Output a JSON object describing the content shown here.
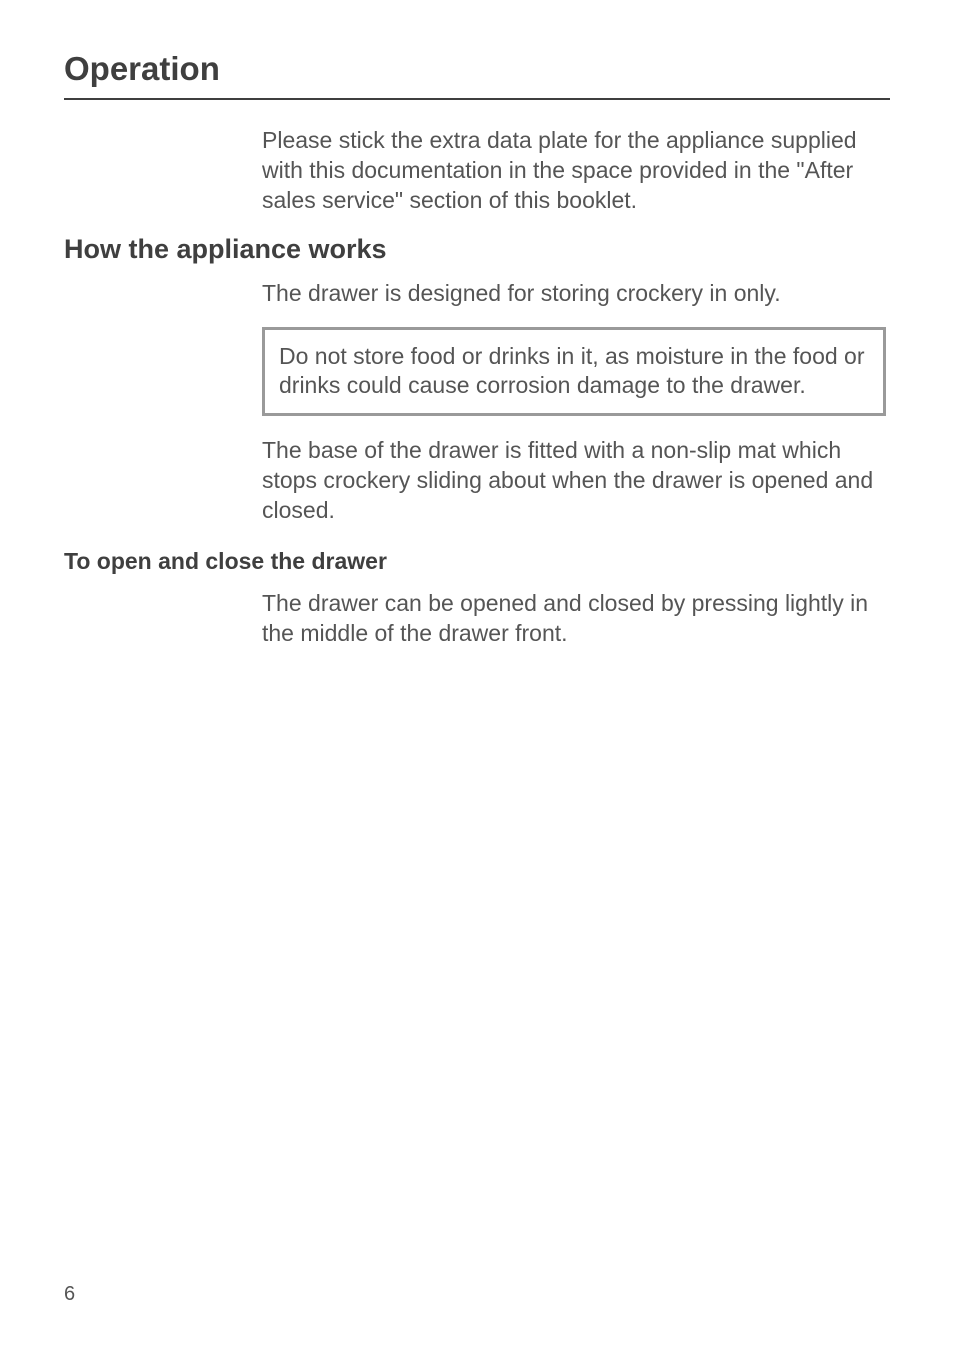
{
  "chapter_title": "Operation",
  "intro_paragraph": "Please stick the extra data plate for the appliance supplied with this documentation in the space provided in the \"After sales service\" section of this booklet.",
  "section1": {
    "heading": "How the appliance works",
    "p1": "The drawer is designed for storing crockery in only.",
    "notice": "Do not store food or drinks in it, as moisture in the food or drinks could cause corrosion damage to the drawer.",
    "p2": "The base of the drawer is fitted with a non-slip mat which stops crockery sliding about when the drawer is opened and closed."
  },
  "section2": {
    "heading": "To open and close the drawer",
    "p1": "The drawer can be opened and closed by pressing lightly in the middle of the drawer front."
  },
  "page_number": "6"
}
